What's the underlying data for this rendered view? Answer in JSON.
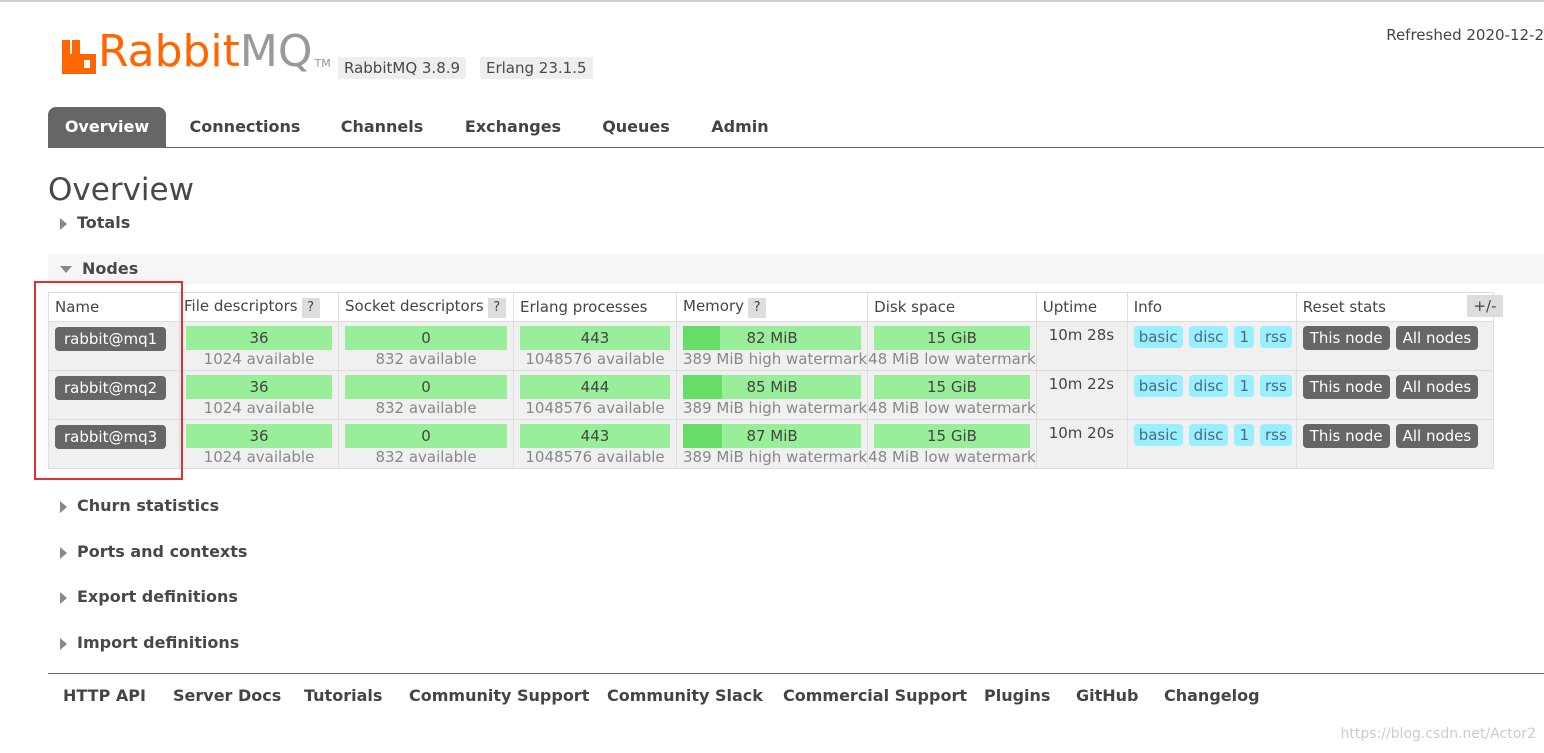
{
  "header": {
    "logo_rabbit": "Rabbit",
    "logo_mq": "MQ",
    "logo_tm": "TM",
    "version_rabbitmq": "RabbitMQ 3.8.9",
    "version_erlang": "Erlang 23.1.5",
    "refreshed": "Refreshed 2020-12-2"
  },
  "nav": {
    "tabs": [
      {
        "label": "Overview",
        "active": true
      },
      {
        "label": "Connections"
      },
      {
        "label": "Channels"
      },
      {
        "label": "Exchanges"
      },
      {
        "label": "Queues"
      },
      {
        "label": "Admin"
      }
    ]
  },
  "page_title": "Overview",
  "sections": {
    "totals": "Totals",
    "nodes": "Nodes",
    "churn": "Churn statistics",
    "ports": "Ports and contexts",
    "export": "Export definitions",
    "import": "Import definitions"
  },
  "nodes_table": {
    "columns": [
      "Name",
      "File descriptors",
      "Socket descriptors",
      "Erlang processes",
      "Memory",
      "Disk space",
      "Uptime",
      "Info",
      "Reset stats"
    ],
    "help_glyph": "?",
    "plus_minus": "+/-",
    "rows": [
      {
        "name": "rabbit@mq1",
        "fd": "36",
        "fd_avail": "1024 available",
        "sd": "0",
        "sd_avail": "832 available",
        "ep": "443",
        "ep_avail": "1048576 available",
        "mem": "82 MiB",
        "mem_fraction": 0.21,
        "mem_sub": "389 MiB high watermark",
        "disk": "15 GiB",
        "disk_sub": "48 MiB low watermark",
        "uptime": "10m 28s",
        "info": [
          "basic",
          "disc",
          "1",
          "rss"
        ],
        "reset_this": "This node",
        "reset_all": "All nodes"
      },
      {
        "name": "rabbit@mq2",
        "fd": "36",
        "fd_avail": "1024 available",
        "sd": "0",
        "sd_avail": "832 available",
        "ep": "444",
        "ep_avail": "1048576 available",
        "mem": "85 MiB",
        "mem_fraction": 0.22,
        "mem_sub": "389 MiB high watermark",
        "disk": "15 GiB",
        "disk_sub": "48 MiB low watermark",
        "uptime": "10m 22s",
        "info": [
          "basic",
          "disc",
          "1",
          "rss"
        ],
        "reset_this": "This node",
        "reset_all": "All nodes"
      },
      {
        "name": "rabbit@mq3",
        "fd": "36",
        "fd_avail": "1024 available",
        "sd": "0",
        "sd_avail": "832 available",
        "ep": "443",
        "ep_avail": "1048576 available",
        "mem": "87 MiB",
        "mem_fraction": 0.22,
        "mem_sub": "389 MiB high watermark",
        "disk": "15 GiB",
        "disk_sub": "48 MiB low watermark",
        "uptime": "10m 20s",
        "info": [
          "basic",
          "disc",
          "1",
          "rss"
        ],
        "reset_this": "This node",
        "reset_all": "All nodes"
      }
    ]
  },
  "footer": {
    "links": [
      "HTTP API",
      "Server Docs",
      "Tutorials",
      "Community Support",
      "Community Slack",
      "Commercial Support",
      "Plugins",
      "GitHub",
      "Changelog"
    ]
  },
  "watermark": "https://blog.csdn.net/Actor2",
  "colors": {
    "brand_orange": "#ff6600",
    "bar_green": "#99ee99",
    "bar_green_fill": "#66dd66",
    "badge_cyan": "#99eeff",
    "highlight_red": "#e03030"
  }
}
